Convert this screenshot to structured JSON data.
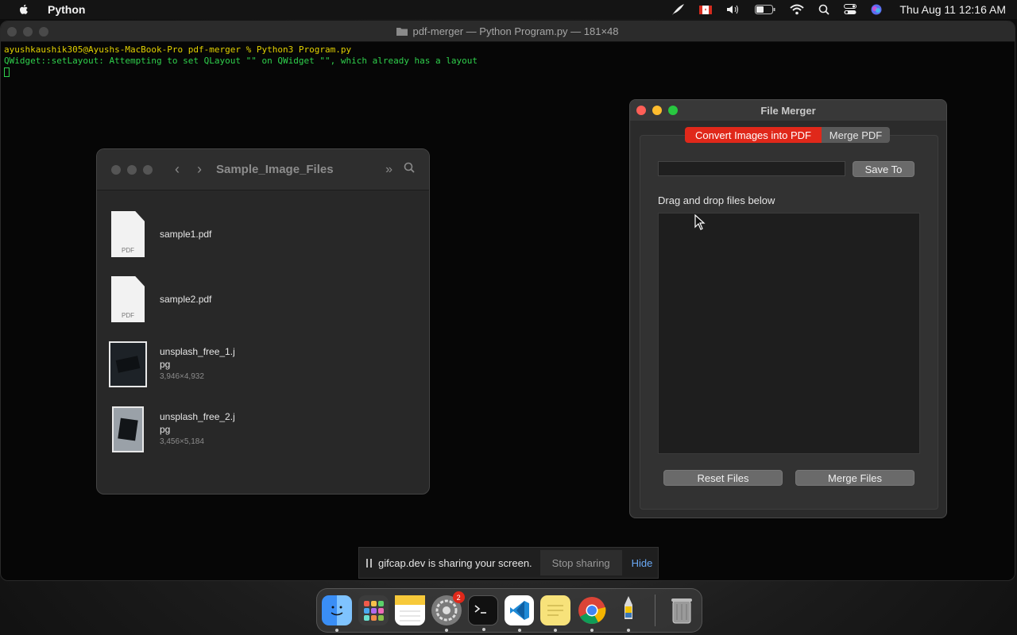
{
  "menubar": {
    "app_name": "Python",
    "clock": "Thu Aug 11  12:16 AM"
  },
  "terminal": {
    "title": "pdf-merger — Python Program.py — 181×48",
    "line1": "ayushkaushik305@Ayushs-MacBook-Pro pdf-merger % Python3 Program.py",
    "line2": "QWidget::setLayout: Attempting to set QLayout \"\" on QWidget \"\", which already has a layout"
  },
  "finder": {
    "title": "Sample_Image_Files",
    "files": [
      {
        "name": "sample1.pdf",
        "dims": "",
        "kind": "PDF"
      },
      {
        "name": "sample2.pdf",
        "dims": "",
        "kind": "PDF"
      },
      {
        "name": "unsplash_free_1.jpg",
        "name_line1": "unsplash_free_1.j",
        "name_line2": "pg",
        "dims": "3,946×4,932"
      },
      {
        "name": "unsplash_free_2.jpg",
        "name_line1": "unsplash_free_2.j",
        "name_line2": "pg",
        "dims": "3,456×5,184"
      }
    ]
  },
  "merger": {
    "title": "File Merger",
    "tabs": [
      {
        "label": "Convert Images into PDF",
        "active": true
      },
      {
        "label": "Merge PDF",
        "active": false
      }
    ],
    "path_value": "",
    "save_label": "Save To",
    "drop_label": "Drag and drop files below",
    "reset_label": "Reset Files",
    "merge_label": "Merge Files",
    "accent": "#e0281a"
  },
  "sharebar": {
    "message": "gifcap.dev is sharing your screen.",
    "stop_label": "Stop sharing",
    "hide_label": "Hide"
  },
  "dock": {
    "items": [
      {
        "name": "finder-icon",
        "running": true
      },
      {
        "name": "launchpad-icon",
        "running": false
      },
      {
        "name": "notes-icon",
        "running": false
      },
      {
        "name": "system-preferences-icon",
        "running": true,
        "badge": "2"
      },
      {
        "name": "terminal-icon",
        "running": true
      },
      {
        "name": "vscode-icon",
        "running": true
      },
      {
        "name": "stickies-icon",
        "running": true
      },
      {
        "name": "chrome-icon",
        "running": true
      },
      {
        "name": "python-launcher-icon",
        "running": true
      },
      {
        "name": "trash-icon",
        "running": false
      }
    ]
  }
}
